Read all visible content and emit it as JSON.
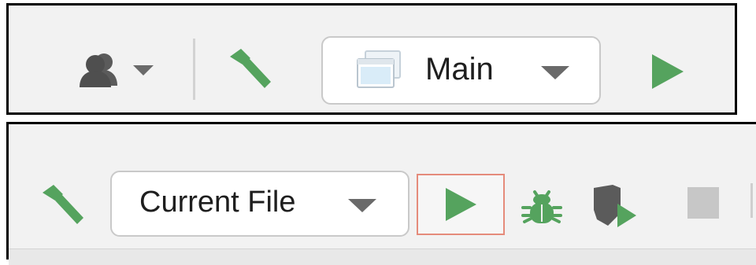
{
  "top_toolbar": {
    "target_selector": {
      "label": "Main"
    },
    "icons": {
      "user": "users-icon",
      "dropdown": "chevron-down-icon",
      "build": "hammer-icon",
      "window": "window-icon",
      "run": "play-icon"
    }
  },
  "bottom_toolbar": {
    "target_selector": {
      "label": "Current File"
    },
    "icons": {
      "build": "hammer-icon",
      "run": "play-icon",
      "debug": "bug-icon",
      "coverage": "shield-run-icon",
      "stop": "stop-icon"
    },
    "colors": {
      "accent_green": "#55a35e",
      "run_highlight_border": "#e58b7b",
      "stop_gray": "#c7c7c7"
    }
  }
}
